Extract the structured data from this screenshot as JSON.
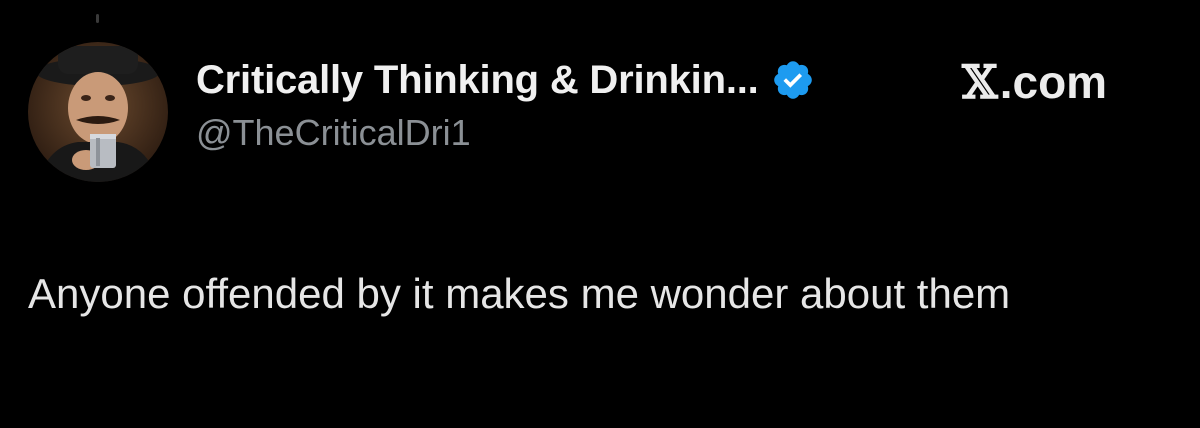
{
  "author": {
    "display_name": "Critically Thinking & Drinkin...",
    "handle": "@TheCriticalDri1",
    "verified_badge_icon": "verified-badge-icon",
    "verified_color": "#1d9bf0"
  },
  "brand": {
    "x_glyph": "𝕏",
    "domain": ".com"
  },
  "tweet": {
    "text": "Anyone offended by it makes me wonder about them"
  },
  "colors": {
    "background": "#000000",
    "text_primary": "#e7e9ea",
    "text_secondary": "#8b9095"
  }
}
